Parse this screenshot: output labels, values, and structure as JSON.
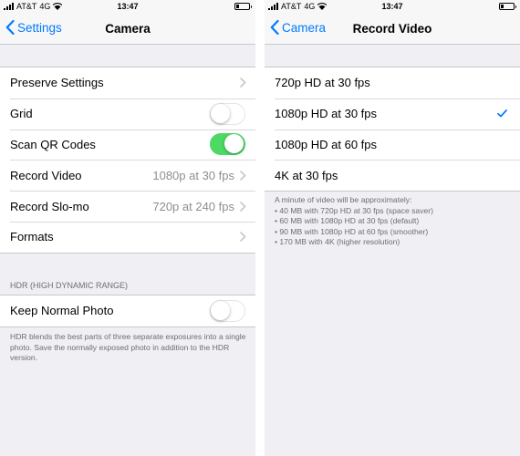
{
  "status_bar": {
    "carrier": "AT&T",
    "network": "4G",
    "time": "13:47",
    "battery_level": 0.25
  },
  "colors": {
    "accent": "#007aff",
    "toggle_on": "#4cd964",
    "secondary_text": "#8e8e93",
    "footer_text": "#6d6d72"
  },
  "camera_screen": {
    "back_label": "Settings",
    "title": "Camera",
    "rows": [
      {
        "label": "Preserve Settings",
        "type": "disclosure",
        "value": ""
      },
      {
        "label": "Grid",
        "type": "toggle",
        "on": false
      },
      {
        "label": "Scan QR Codes",
        "type": "toggle",
        "on": true
      },
      {
        "label": "Record Video",
        "type": "disclosure",
        "value": "1080p at 30 fps"
      },
      {
        "label": "Record Slo-mo",
        "type": "disclosure",
        "value": "720p at 240 fps"
      },
      {
        "label": "Formats",
        "type": "disclosure",
        "value": ""
      }
    ],
    "hdr_header": "HDR (HIGH DYNAMIC RANGE)",
    "hdr_row": {
      "label": "Keep Normal Photo",
      "type": "toggle",
      "on": false
    },
    "hdr_footer": "HDR blends the best parts of three separate exposures into a single photo. Save the normally exposed photo in addition to the HDR version."
  },
  "record_video_screen": {
    "back_label": "Camera",
    "title": "Record Video",
    "options": [
      {
        "label": "720p HD at 30 fps",
        "selected": false
      },
      {
        "label": "1080p HD at 30 fps",
        "selected": true
      },
      {
        "label": "1080p HD at 60 fps",
        "selected": false
      },
      {
        "label": "4K at 30 fps",
        "selected": false
      }
    ],
    "footer_intro": "A minute of video will be approximately:",
    "footer_items": [
      "• 40 MB with 720p HD at 30 fps (space saver)",
      "• 60 MB with 1080p HD at 30 fps (default)",
      "• 90 MB with 1080p HD at 60 fps (smoother)",
      "• 170 MB with 4K (higher resolution)"
    ]
  }
}
